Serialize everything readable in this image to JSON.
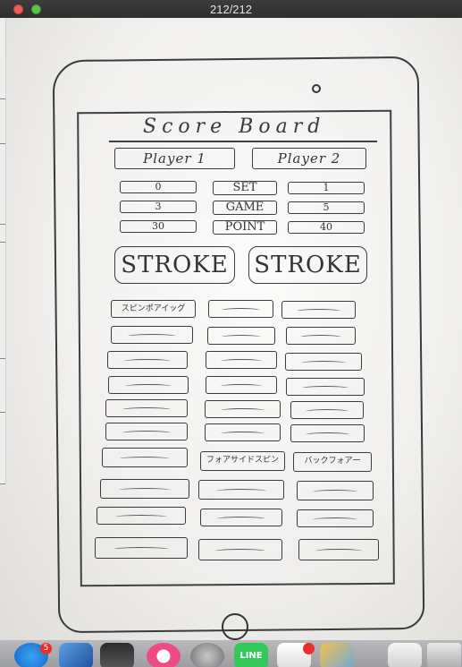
{
  "window": {
    "title": "212/212"
  },
  "sketch": {
    "title": "Score Board",
    "players": [
      "Player 1",
      "Player 2"
    ],
    "score_rows": [
      {
        "p1": "0",
        "label": "SET",
        "p2": "1"
      },
      {
        "p1": "3",
        "label": "GAME",
        "p2": "5"
      },
      {
        "p1": "30",
        "label": "POINT",
        "p2": "40"
      }
    ],
    "stroke_buttons": [
      "STROKE",
      "STROKE"
    ],
    "shot_labels": {
      "r0c0": "スピンポアイッグ",
      "r6c1": "フォアサイドスピン",
      "r6c2": "バックフォア一"
    }
  },
  "dock": {
    "appstore_badge": "5",
    "line_label": "LINE",
    "icons": [
      "appstore-icon",
      "xcode-icon",
      "imovie-icon",
      "itunes-icon",
      "system-preferences-icon",
      "line-icon",
      "slack-icon",
      "photos-icon",
      "finder-icon",
      "trash-icon"
    ]
  }
}
